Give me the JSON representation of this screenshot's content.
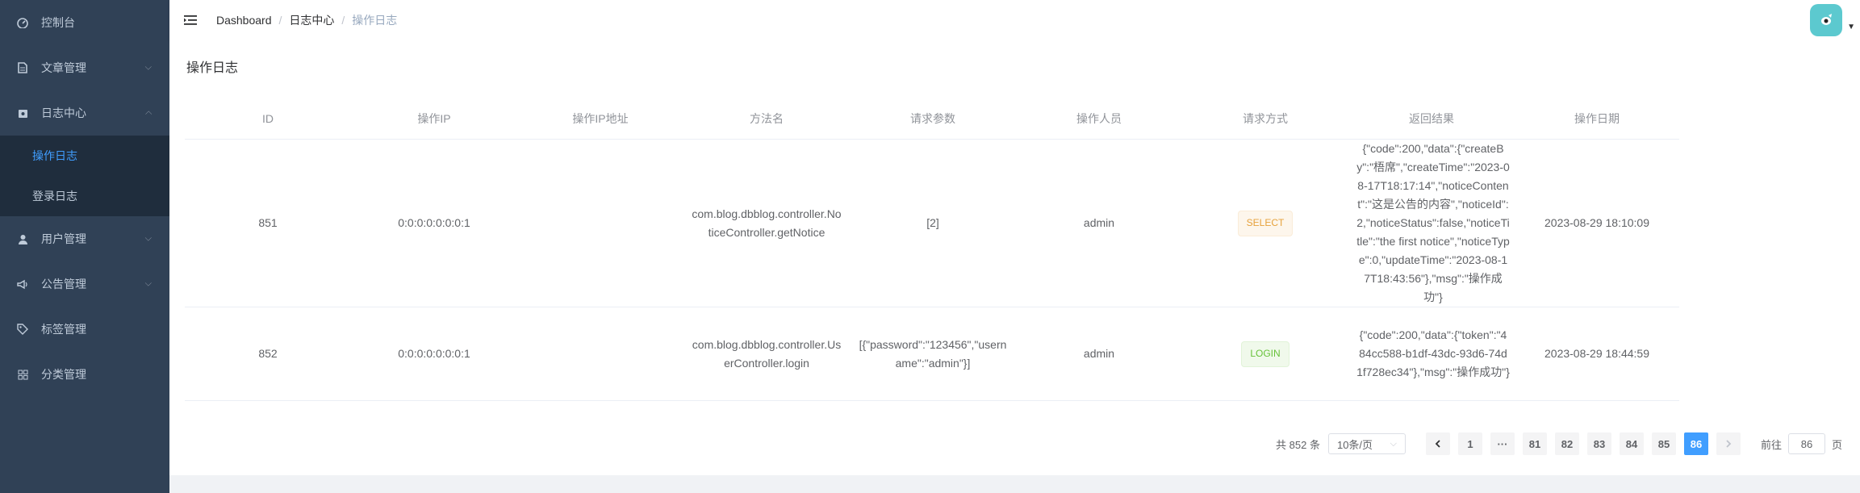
{
  "sidebar": {
    "items": [
      {
        "label": "控制台",
        "icon": "dashboard-icon"
      },
      {
        "label": "文章管理",
        "icon": "document-icon"
      },
      {
        "label": "日志中心",
        "icon": "log-icon"
      },
      {
        "label": "用户管理",
        "icon": "user-icon"
      },
      {
        "label": "公告管理",
        "icon": "megaphone-icon"
      },
      {
        "label": "标签管理",
        "icon": "tag-icon"
      },
      {
        "label": "分类管理",
        "icon": "grid-icon"
      }
    ],
    "log_sub": [
      "操作日志",
      "登录日志"
    ]
  },
  "breadcrumb": {
    "home": "Dashboard",
    "middle": "日志中心",
    "current": "操作日志",
    "sep": "/"
  },
  "page": {
    "title": "操作日志"
  },
  "table": {
    "headers": [
      "ID",
      "操作IP",
      "操作IP地址",
      "方法名",
      "请求参数",
      "操作人员",
      "请求方式",
      "返回结果",
      "操作日期"
    ],
    "rows": [
      {
        "id": "851",
        "ip": "0:0:0:0:0:0:0:1",
        "ip_addr": "",
        "method": "com.blog.dbblog.controller.NoticeController.getNotice",
        "params": "[2]",
        "operator": "admin",
        "type": "SELECT",
        "result": "{\"code\":200,\"data\":{\"createBy\":\"梧席\",\"createTime\":\"2023-08-17T18:17:14\",\"noticeContent\":\"这是公告的内容\",\"noticeId\":2,\"noticeStatus\":false,\"noticeTitle\":\"the first notice\",\"noticeType\":0,\"updateTime\":\"2023-08-17T18:43:56\"},\"msg\":\"操作成功\"}",
        "date": "2023-08-29 18:10:09"
      },
      {
        "id": "852",
        "ip": "0:0:0:0:0:0:0:1",
        "ip_addr": "",
        "method": "com.blog.dbblog.controller.UserController.login",
        "params": "[{\"password\":\"123456\",\"username\":\"admin\"}]",
        "operator": "admin",
        "type": "LOGIN",
        "result": "{\"code\":200,\"data\":{\"token\":\"484cc588-b1df-43dc-93d6-74d1f728ec34\"},\"msg\":\"操作成功\"}",
        "date": "2023-08-29 18:44:59"
      }
    ]
  },
  "pagination": {
    "total": "共 852 条",
    "page_size": "10条/页",
    "first": "1",
    "more": "···",
    "pages": [
      "81",
      "82",
      "83",
      "84",
      "85",
      "86"
    ],
    "current": "86",
    "goto_label": "前往",
    "goto_value": "86",
    "page_suffix": "页"
  },
  "colors": {
    "sidebar_bg": "#304156",
    "active": "#409eff"
  }
}
